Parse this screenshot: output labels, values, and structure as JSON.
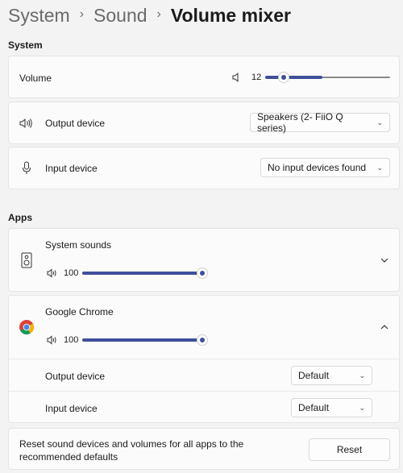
{
  "breadcrumb": {
    "system": "System",
    "sound": "Sound",
    "current": "Volume mixer",
    "sep": "›"
  },
  "system_section": {
    "title": "System",
    "volume_label": "Volume",
    "volume_value": "12",
    "volume_level": 0.12,
    "output_label": "Output device",
    "output_value": "Speakers (2- FiiO Q series)",
    "input_label": "Input device",
    "input_value": "No input devices found"
  },
  "apps_section": {
    "title": "Apps",
    "apps": [
      {
        "name": "System sounds",
        "volume": "100",
        "expanded": false
      },
      {
        "name": "Google Chrome",
        "volume": "100",
        "expanded": true,
        "output_label": "Output device",
        "output_value": "Default",
        "input_label": "Input device",
        "input_value": "Default"
      }
    ]
  },
  "reset": {
    "text_line1": "Reset sound devices and volumes for all apps to the",
    "text_line2": "recommended defaults",
    "button_label": "Reset"
  },
  "colors": {
    "accent": "#3e4f9a",
    "background": "#f3f3f3",
    "card": "#fbfbfb"
  },
  "icons": [
    "speaker-icon",
    "microphone-icon",
    "chevron-down-icon",
    "chevron-up-icon",
    "system-sounds-icon",
    "chrome-icon"
  ]
}
